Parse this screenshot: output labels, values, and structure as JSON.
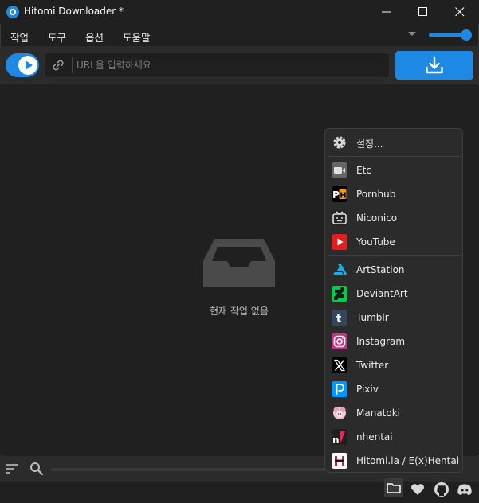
{
  "window": {
    "title": "Hitomi Downloader *"
  },
  "menu": {
    "items": [
      "작업",
      "도구",
      "옵션",
      "도움말"
    ]
  },
  "toolbar": {
    "url_placeholder": "URL을 입력하세요"
  },
  "main": {
    "empty_text": "현재 작업 없음"
  },
  "popup": {
    "settings_label": "설정...",
    "sites": [
      {
        "label": "Etc",
        "icon": "video-camera-icon",
        "color": "#666666"
      },
      {
        "label": "Pornhub",
        "icon": "pornhub-icon",
        "color": "#000000"
      },
      {
        "label": "Niconico",
        "icon": "niconico-icon",
        "color": "#252525"
      },
      {
        "label": "YouTube",
        "icon": "youtube-icon",
        "color": "#e02020"
      },
      {
        "label": "ArtStation",
        "icon": "artstation-icon",
        "color": "#13aff0"
      },
      {
        "label": "DeviantArt",
        "icon": "deviantart-icon",
        "color": "#05cc47"
      },
      {
        "label": "Tumblr",
        "icon": "tumblr-icon",
        "color": "#35465c"
      },
      {
        "label": "Instagram",
        "icon": "instagram-icon",
        "color": "#c13584"
      },
      {
        "label": "Twitter",
        "icon": "twitter-x-icon",
        "color": "#000000"
      },
      {
        "label": "Pixiv",
        "icon": "pixiv-icon",
        "color": "#0096fa"
      },
      {
        "label": "Manatoki",
        "icon": "manatoki-icon",
        "color": "#e8a0b8"
      },
      {
        "label": "nhentai",
        "icon": "nhentai-icon",
        "color": "#1f1f1f"
      },
      {
        "label": "Hitomi.la / E(x)Hentai",
        "icon": "hitomi-icon",
        "color": "#ffffff"
      }
    ]
  },
  "colors": {
    "accent": "#1e88e5",
    "background": "#202020",
    "panel": "#2b2b2b"
  }
}
